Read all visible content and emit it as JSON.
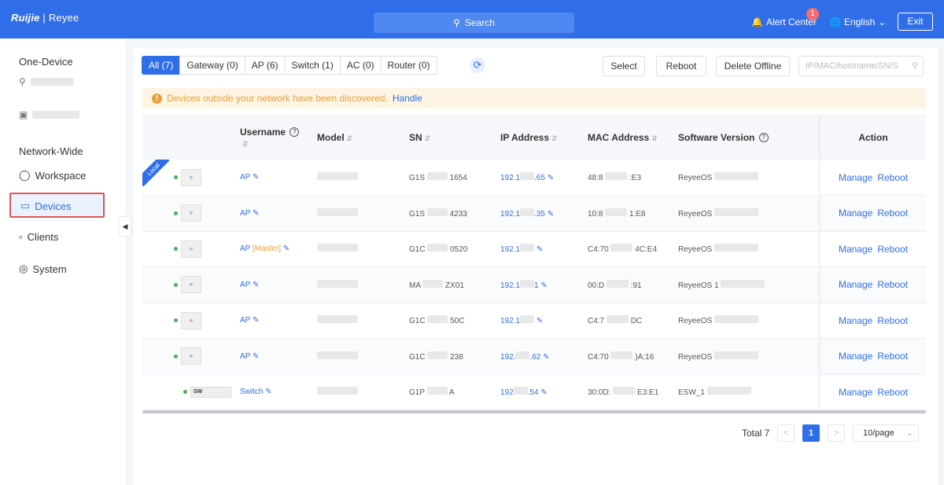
{
  "app": {
    "logo_brand": "Ruijie",
    "logo_sep": " | ",
    "logo_product": "Reyee"
  },
  "header": {
    "search_label": "Search",
    "alert_label": "Alert Center",
    "alert_count": "1",
    "language": "English",
    "exit_label": "Exit"
  },
  "sidebar": {
    "one_device": "One-Device",
    "network_wide": "Network-Wide",
    "items": [
      {
        "label": "Workspace",
        "icon": "workspace-icon"
      },
      {
        "label": "Devices",
        "icon": "devices-icon"
      },
      {
        "label": "Clients",
        "icon": "clients-icon"
      },
      {
        "label": "System",
        "icon": "system-icon"
      }
    ]
  },
  "tabs": [
    "All (7)",
    "Gateway (0)",
    "AP (6)",
    "Switch (1)",
    "AC (0)",
    "Router (0)"
  ],
  "toolbar": {
    "select": "Select",
    "reboot": "Reboot",
    "delete_offline": "Delete Offline",
    "filter_placeholder": "IP/MAC/hostname/SN/S"
  },
  "notice": {
    "text": "Devices outside your network have been discovered.",
    "handle": "Handle"
  },
  "table": {
    "headers": {
      "username": "Username",
      "model": "Model",
      "sn": "SN",
      "ip": "IP Address",
      "mac": "MAC Address",
      "software": "Software Version",
      "action": "Action"
    },
    "local_tag": "Local",
    "manage": "Manage",
    "reboot": "Reboot",
    "rows": [
      {
        "type": "AP",
        "username": "AP",
        "model": "",
        "sn_pre": "G1S",
        "sn_suf": "1654",
        "ip_pre": "192.1",
        "ip_suf": ".65",
        "mac_pre": "48:8",
        "mac_suf": ":E3",
        "sw": "ReyeeOS"
      },
      {
        "type": "AP",
        "username": "AP",
        "model": "",
        "sn_pre": "G1S",
        "sn_suf": "4233",
        "ip_pre": "192.1",
        "ip_suf": ".35",
        "mac_pre": "10:8",
        "mac_suf": "1:E8",
        "sw": "ReyeeOS"
      },
      {
        "type": "AP",
        "username": "AP",
        "username_extra": "[Master]",
        "model": "",
        "sn_pre": "G1C",
        "sn_suf": "0520",
        "ip_pre": "192.1",
        "ip_suf": "",
        "mac_pre": "C4:70",
        "mac_suf": "4C:E4",
        "sw": "ReyeeOS"
      },
      {
        "type": "AP",
        "username": "AP",
        "model": "",
        "sn_pre": "MA",
        "sn_suf": "ZX01",
        "ip_pre": "192.1",
        "ip_suf": "1",
        "mac_pre": "00:D",
        "mac_suf": ":91",
        "sw": "ReyeeOS 1"
      },
      {
        "type": "AP",
        "username": "AP",
        "model": "",
        "sn_pre": "G1C",
        "sn_suf": "50C",
        "ip_pre": "192.1",
        "ip_suf": "",
        "mac_pre": "C4:7",
        "mac_suf": "DC",
        "sw": "ReyeeOS"
      },
      {
        "type": "AP",
        "username": "AP",
        "model": "",
        "sn_pre": "G1C",
        "sn_suf": "238",
        "ip_pre": "192.",
        "ip_suf": ".62",
        "mac_pre": "C4:70",
        "mac_suf": ")A:16",
        "sw": "ReyeeOS"
      },
      {
        "type": "Switch",
        "username": "Switch",
        "model": "",
        "sn_pre": "G1P",
        "sn_suf": "A",
        "ip_pre": "192",
        "ip_suf": ".54",
        "mac_pre": "30:0D:",
        "mac_suf": "E3:E1",
        "sw": "ESW_1"
      }
    ]
  },
  "pagination": {
    "total": "Total 7",
    "page": "1",
    "per_page": "10/page"
  }
}
